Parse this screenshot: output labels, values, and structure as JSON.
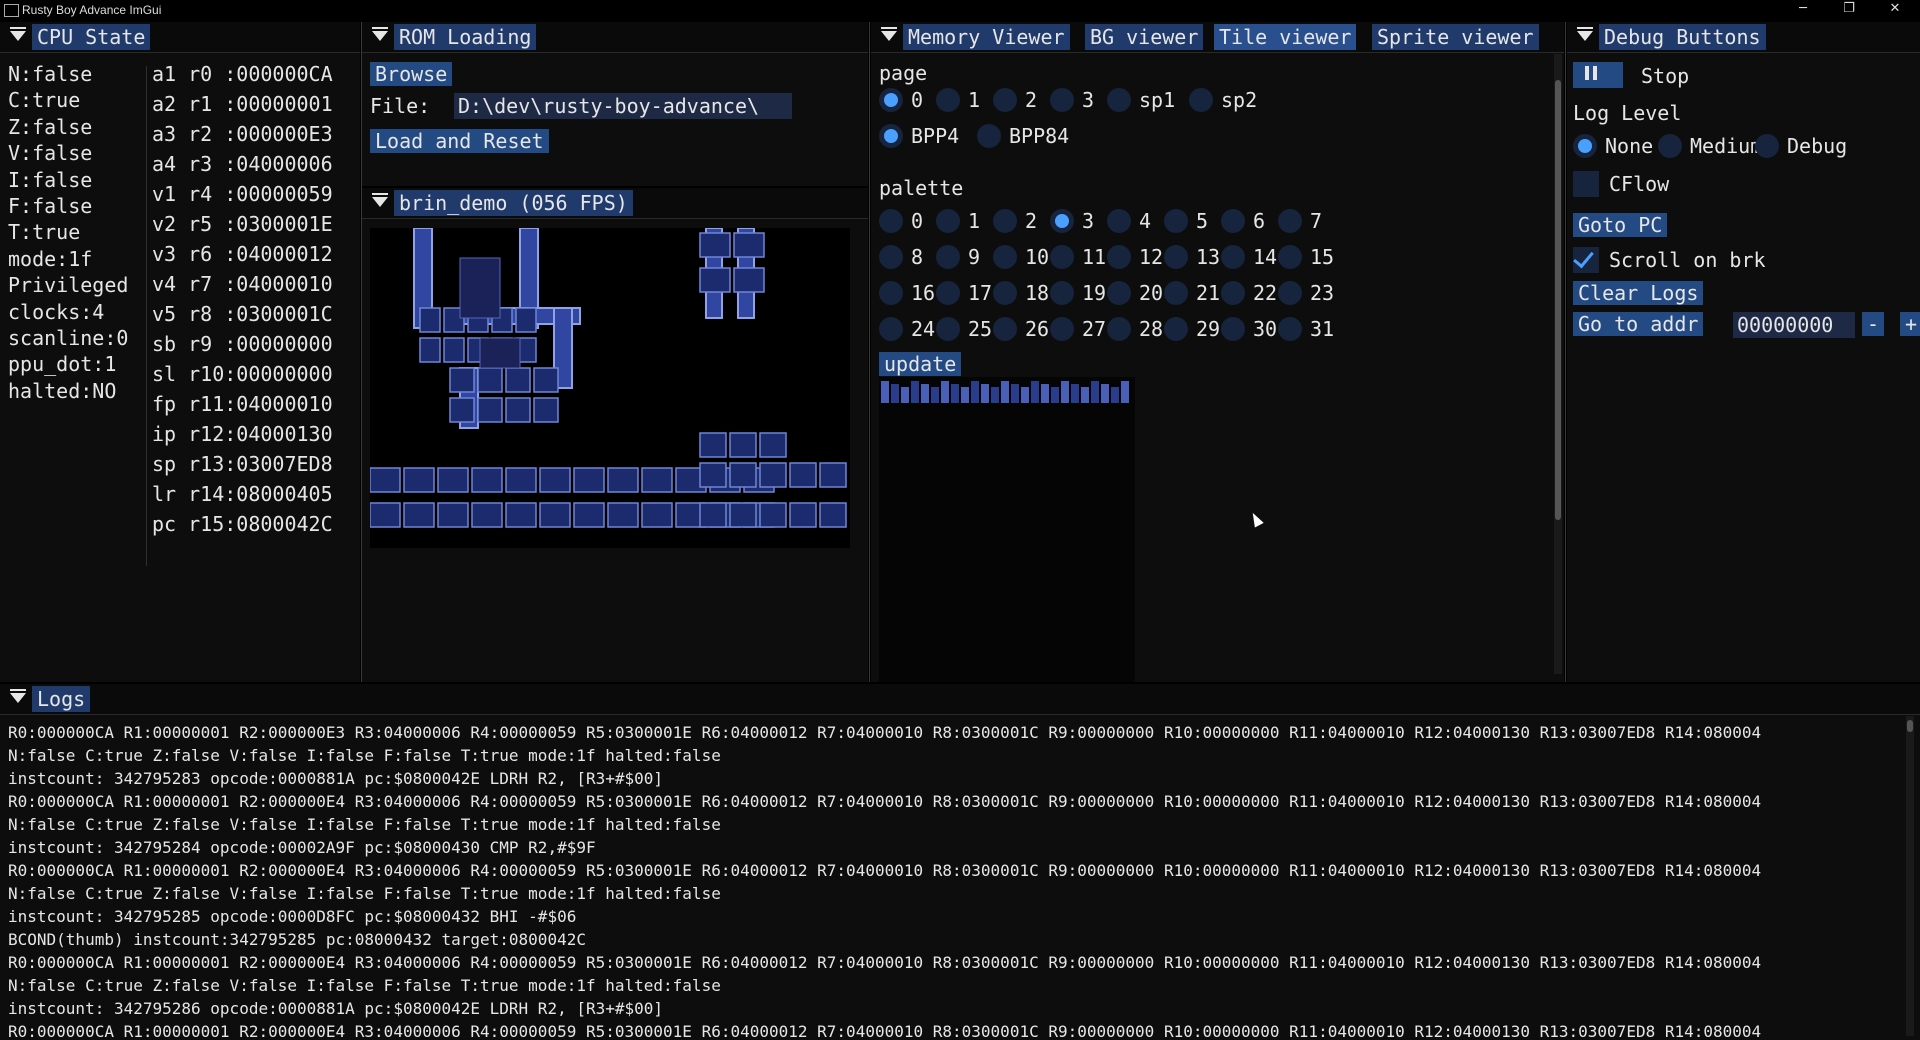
{
  "window": {
    "title": "Rusty Boy Advance ImGui",
    "min_label": "─",
    "restore_label": "❐",
    "close_label": "✕"
  },
  "cpu_state": {
    "title": "CPU State",
    "flags": [
      "N:false",
      "C:true",
      "Z:false",
      "V:false",
      "I:false",
      "F:false",
      "T:true",
      "mode:1f",
      "Privileged",
      "clocks:4",
      "scanline:0",
      "ppu_dot:1",
      "halted:NO"
    ],
    "registers": [
      "a1 r0 :000000CA",
      "a2 r1 :00000001",
      "a3 r2 :000000E3",
      "a4 r3 :04000006",
      "v1 r4 :00000059",
      "v2 r5 :0300001E",
      "v3 r6 :04000012",
      "v4 r7 :04000010",
      "v5 r8 :0300001C",
      "sb r9 :00000000",
      "sl r10:00000000",
      "fp r11:04000010",
      "ip r12:04000130",
      "sp r13:03007ED8",
      "lr r14:08000405",
      "pc r15:0800042C"
    ]
  },
  "rom_loading": {
    "title": "ROM Loading",
    "browse_label": "Browse",
    "file_label": "File:",
    "file_value": "D:\\dev\\rusty-boy-advance\\",
    "load_reset_label": "Load and Reset"
  },
  "game_view": {
    "title": "brin_demo (056 FPS)"
  },
  "viewer": {
    "tabs": [
      "Memory Viewer",
      "BG viewer",
      "Tile viewer",
      "Sprite viewer"
    ],
    "active_tab": "Tile viewer",
    "page_label": "page",
    "page_options": [
      "0",
      "1",
      "2",
      "3",
      "sp1",
      "sp2"
    ],
    "page_selected": "0",
    "bpp_options": [
      "BPP4",
      "BPP84"
    ],
    "bpp_selected": "BPP4",
    "palette_label": "palette",
    "palette_options": [
      "0",
      "1",
      "2",
      "3",
      "4",
      "5",
      "6",
      "7",
      "8",
      "9",
      "10",
      "11",
      "12",
      "13",
      "14",
      "15",
      "16",
      "17",
      "18",
      "19",
      "20",
      "21",
      "22",
      "23",
      "24",
      "25",
      "26",
      "27",
      "28",
      "29",
      "30",
      "31"
    ],
    "palette_selected": "3",
    "update_label": "update"
  },
  "debug": {
    "title": "Debug Buttons",
    "stop_label": "Stop",
    "log_level_label": "Log Level",
    "log_levels": [
      "None",
      "Medium",
      "Debug"
    ],
    "log_level_selected": "None",
    "cflow_label": "CFlow",
    "cflow_checked": false,
    "goto_pc_label": "Goto PC",
    "scroll_brk_label": "Scroll on brk",
    "scroll_brk_checked": true,
    "clear_logs_label": "Clear Logs",
    "go_to_addr_label": "Go to addr",
    "addr_value": "00000000",
    "minus_label": "-",
    "plus_label": "+"
  },
  "logs": {
    "title": "Logs",
    "lines": [
      "R0:000000CA R1:00000001 R2:000000E3 R3:04000006 R4:00000059 R5:0300001E R6:04000012 R7:04000010 R8:0300001C R9:00000000 R10:00000000 R11:04000010 R12:04000130 R13:03007ED8 R14:080004",
      "N:false C:true Z:false V:false I:false F:false T:true mode:1f halted:false",
      "instcount: 342795283 opcode:0000881A pc:$0800042E  LDRH R2, [R3+#$00]",
      "R0:000000CA R1:00000001 R2:000000E4 R3:04000006 R4:00000059 R5:0300001E R6:04000012 R7:04000010 R8:0300001C R9:00000000 R10:00000000 R11:04000010 R12:04000130 R13:03007ED8 R14:080004",
      "N:false C:true Z:false V:false I:false F:false T:true mode:1f halted:false",
      "instcount: 342795284 opcode:00002A9F pc:$08000430  CMP R2,#$9F",
      "R0:000000CA R1:00000001 R2:000000E4 R3:04000006 R4:00000059 R5:0300001E R6:04000012 R7:04000010 R8:0300001C R9:00000000 R10:00000000 R11:04000010 R12:04000130 R13:03007ED8 R14:080004",
      "N:false C:true Z:false V:false I:false F:false T:true mode:1f halted:false",
      "instcount: 342795285 opcode:0000D8FC pc:$08000432  BHI -#$06",
      "BCOND(thumb) instcount:342795285 pc:08000432 target:0800042C",
      "R0:000000CA R1:00000001 R2:000000E4 R3:04000006 R4:00000059 R5:0300001E R6:04000012 R7:04000010 R8:0300001C R9:00000000 R10:00000000 R11:04000010 R12:04000130 R13:03007ED8 R14:080004",
      "N:false C:true Z:false V:false I:false F:false T:true mode:1f halted:false",
      "instcount: 342795286 opcode:0000881A pc:$0800042E  LDRH R2, [R3+#$00]",
      "R0:000000CA R1:00000001 R2:000000E4 R3:04000006 R4:00000059 R5:0300001E R6:04000012 R7:04000010 R8:0300001C R9:00000000 R10:00000000 R11:04000010 R12:04000130 R13:03007ED8 R14:080004"
    ]
  },
  "colors": {
    "accent": "#4aa0ff",
    "tab_bg": "#1f3a6b",
    "button_bg": "#234a82"
  }
}
